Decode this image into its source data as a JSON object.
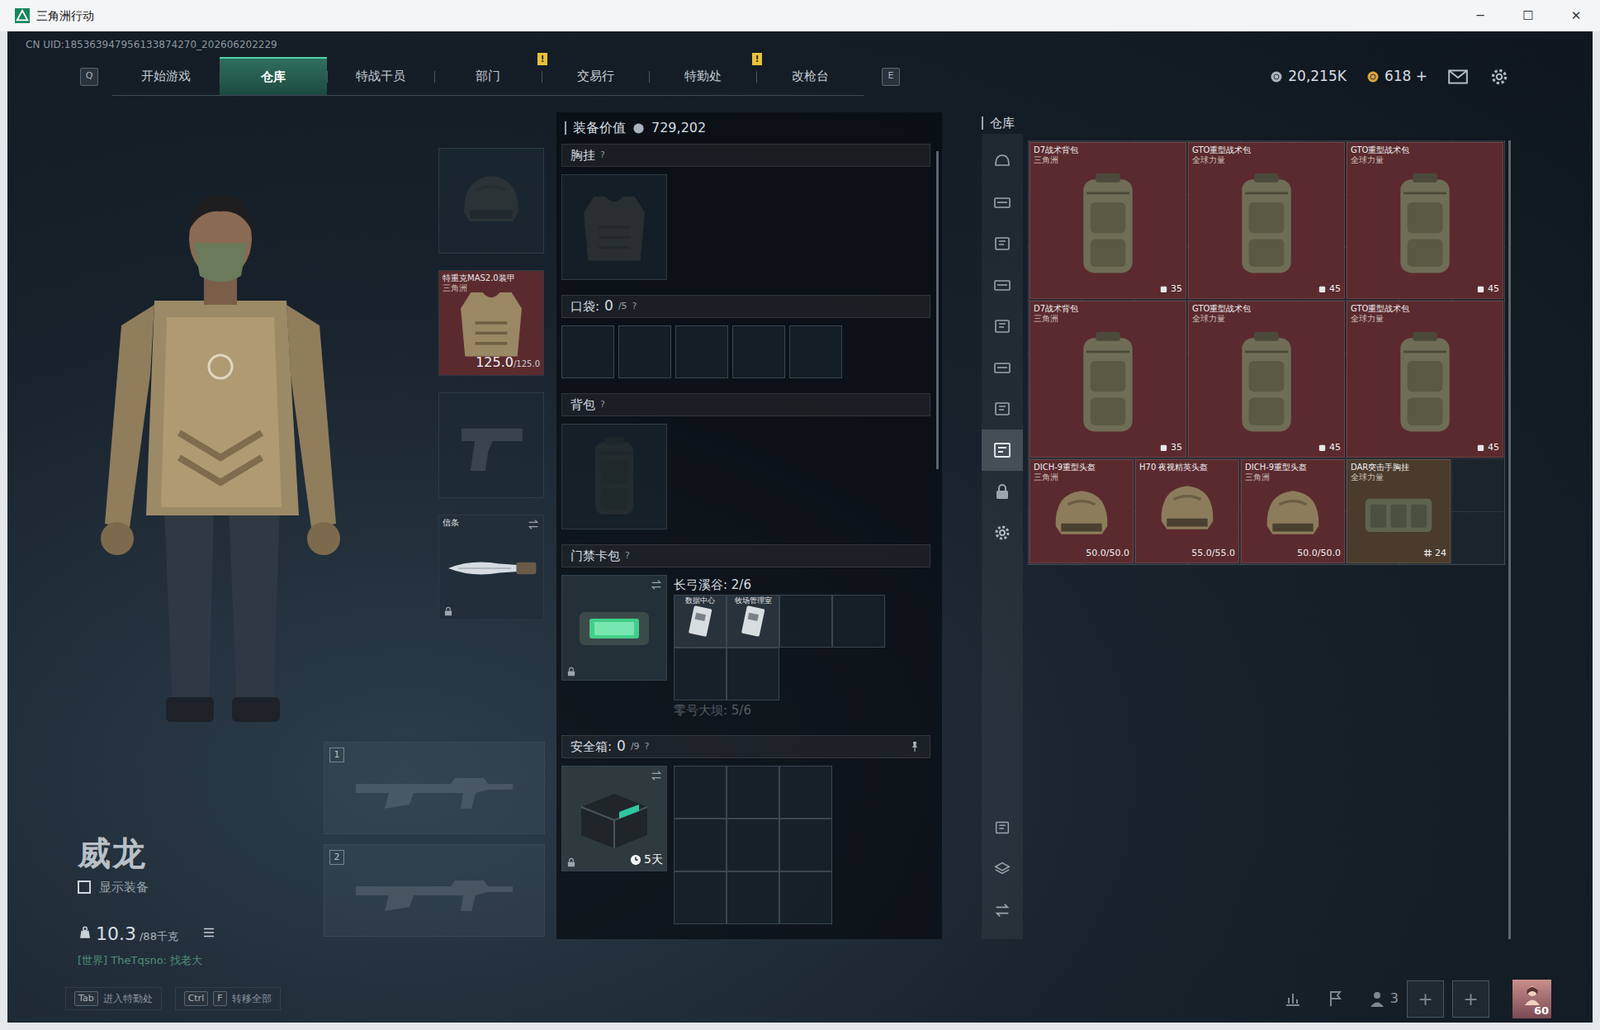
{
  "window": {
    "title": "三角洲行动",
    "controls": [
      "─",
      "☐",
      "✕"
    ]
  },
  "uid": "CN UID:185363947956133874270_202606202229",
  "nav": {
    "prev_key": "Q",
    "next_key": "E",
    "tabs": [
      {
        "label": "开始游戏",
        "selected": false
      },
      {
        "label": "仓库",
        "selected": true
      },
      {
        "label": "特战干员",
        "selected": false
      },
      {
        "label": "部门",
        "selected": false,
        "badge": "!"
      },
      {
        "label": "交易行",
        "selected": false
      },
      {
        "label": "特勤处",
        "selected": false,
        "badge": "!"
      },
      {
        "label": "改枪台",
        "selected": false
      }
    ]
  },
  "currency": [
    {
      "amount": "20,215K"
    },
    {
      "amount": "618 +"
    }
  ],
  "operator": {
    "name": "威龙",
    "show_gear": {
      "label": "显示装备",
      "checked": false
    },
    "weight": "10.3",
    "weight_limit": "/88千克",
    "chat": "[世界] TheTqsno: 找老大"
  },
  "gear_slots": [
    {
      "kind": "helmet",
      "filled": false
    },
    {
      "kind": "armor",
      "filled": true,
      "name": "特重克MAS2.0装甲",
      "faction": "三角洲",
      "durability": "125.0",
      "durability_max": "/125.0",
      "color": "#5b2a2e"
    },
    {
      "kind": "pistol",
      "filled": false
    },
    {
      "kind": "melee",
      "filled": true,
      "name": "信条",
      "locked": true,
      "color": "#222e39"
    }
  ],
  "weapon_slots": [
    {
      "number": "1",
      "filled": false
    },
    {
      "number": "2",
      "filled": false
    }
  ],
  "loadout": {
    "value_label": "装备价值",
    "value": "729,202",
    "chest_rig": {
      "title": "胸挂",
      "help": "?",
      "filled": false
    },
    "pockets": {
      "title": "口袋:",
      "used": "0",
      "capacity": "/5",
      "help": "?",
      "slots": [
        {
          "filled": false
        },
        {
          "filled": false
        },
        {
          "filled": false
        },
        {
          "filled": false
        },
        {
          "filled": false
        }
      ]
    },
    "backpack": {
      "title": "背包",
      "help": "?",
      "filled": false
    },
    "keycard_case": {
      "title": "门禁卡包",
      "help": "?",
      "locked": true,
      "maps": [
        {
          "name": "长弓溪谷: 2/6",
          "dimmed": false,
          "slots": [
            {
              "filled": true,
              "label": "数据中心"
            },
            {
              "filled": true,
              "label": "牧场管理室"
            },
            {
              "filled": false
            },
            {
              "filled": false
            },
            {
              "filled": false
            },
            {
              "filled": false
            }
          ]
        },
        {
          "name": "零号大坝: 5/6",
          "dimmed": true
        }
      ]
    },
    "safe_box": {
      "title": "安全箱:",
      "used": "0",
      "capacity": "/9",
      "help": "?",
      "locked": true,
      "timer": "5天",
      "slots": [
        {
          "filled": false
        },
        {
          "filled": false
        },
        {
          "filled": false
        },
        {
          "filled": false
        },
        {
          "filled": false
        },
        {
          "filled": false
        },
        {
          "filled": false
        },
        {
          "filled": false
        },
        {
          "filled": false
        }
      ]
    }
  },
  "stash": {
    "title": "仓库",
    "side_tabs": [
      {
        "selected": false
      },
      {
        "selected": false
      },
      {
        "selected": false
      },
      {
        "selected": false
      },
      {
        "selected": false
      },
      {
        "selected": false
      },
      {
        "selected": false
      },
      {
        "selected": true
      },
      {
        "selected": false
      },
      {
        "selected": false
      }
    ],
    "items": [
      {
        "name": "D7战术背包",
        "faction": "三角洲",
        "kind": "backpack",
        "stat": "35",
        "color": "#5b2a2e"
      },
      {
        "name": "GTO重型战术包",
        "faction": "全球力量",
        "kind": "backpack",
        "stat": "45",
        "color": "#5b2a2e"
      },
      {
        "name": "GTO重型战术包",
        "faction": "全球力量",
        "kind": "backpack",
        "stat": "45",
        "color": "#5b2a2e"
      },
      {
        "name": "D7战术背包",
        "faction": "三角洲",
        "kind": "backpack",
        "stat": "35",
        "color": "#5b2a2e"
      },
      {
        "name": "GTO重型战术包",
        "faction": "全球力量",
        "kind": "backpack",
        "stat": "45",
        "color": "#5b2a2e"
      },
      {
        "name": "GTO重型战术包",
        "faction": "全球力量",
        "kind": "backpack",
        "stat": "45",
        "color": "#5b2a2e"
      },
      {
        "name": "DICH-9重型头盔",
        "faction": "三角洲",
        "kind": "helmet",
        "stat": "50.0/50.0",
        "color": "#5b2a2e"
      },
      {
        "name": "H70 夜视精英头盔",
        "kind": "helmet",
        "stat": "55.0/55.0",
        "color": "#5b2a2e"
      },
      {
        "name": "DICH-9重型头盔",
        "faction": "三角洲",
        "kind": "helmet",
        "stat": "50.0/50.0",
        "color": "#5b2a2e"
      },
      {
        "name": "DAR突击手胸挂",
        "faction": "全球力量",
        "kind": "rig",
        "stat": "24",
        "color": "#4a3b2c"
      }
    ]
  },
  "hotkeys": [
    {
      "keys": [
        "Tab"
      ],
      "label": "进入特勤处"
    },
    {
      "keys": [
        "Ctrl",
        "F"
      ],
      "label": "转移全部"
    }
  ],
  "social": {
    "friends": "3",
    "invite_slots": [
      "+",
      "+"
    ],
    "level": "60"
  }
}
